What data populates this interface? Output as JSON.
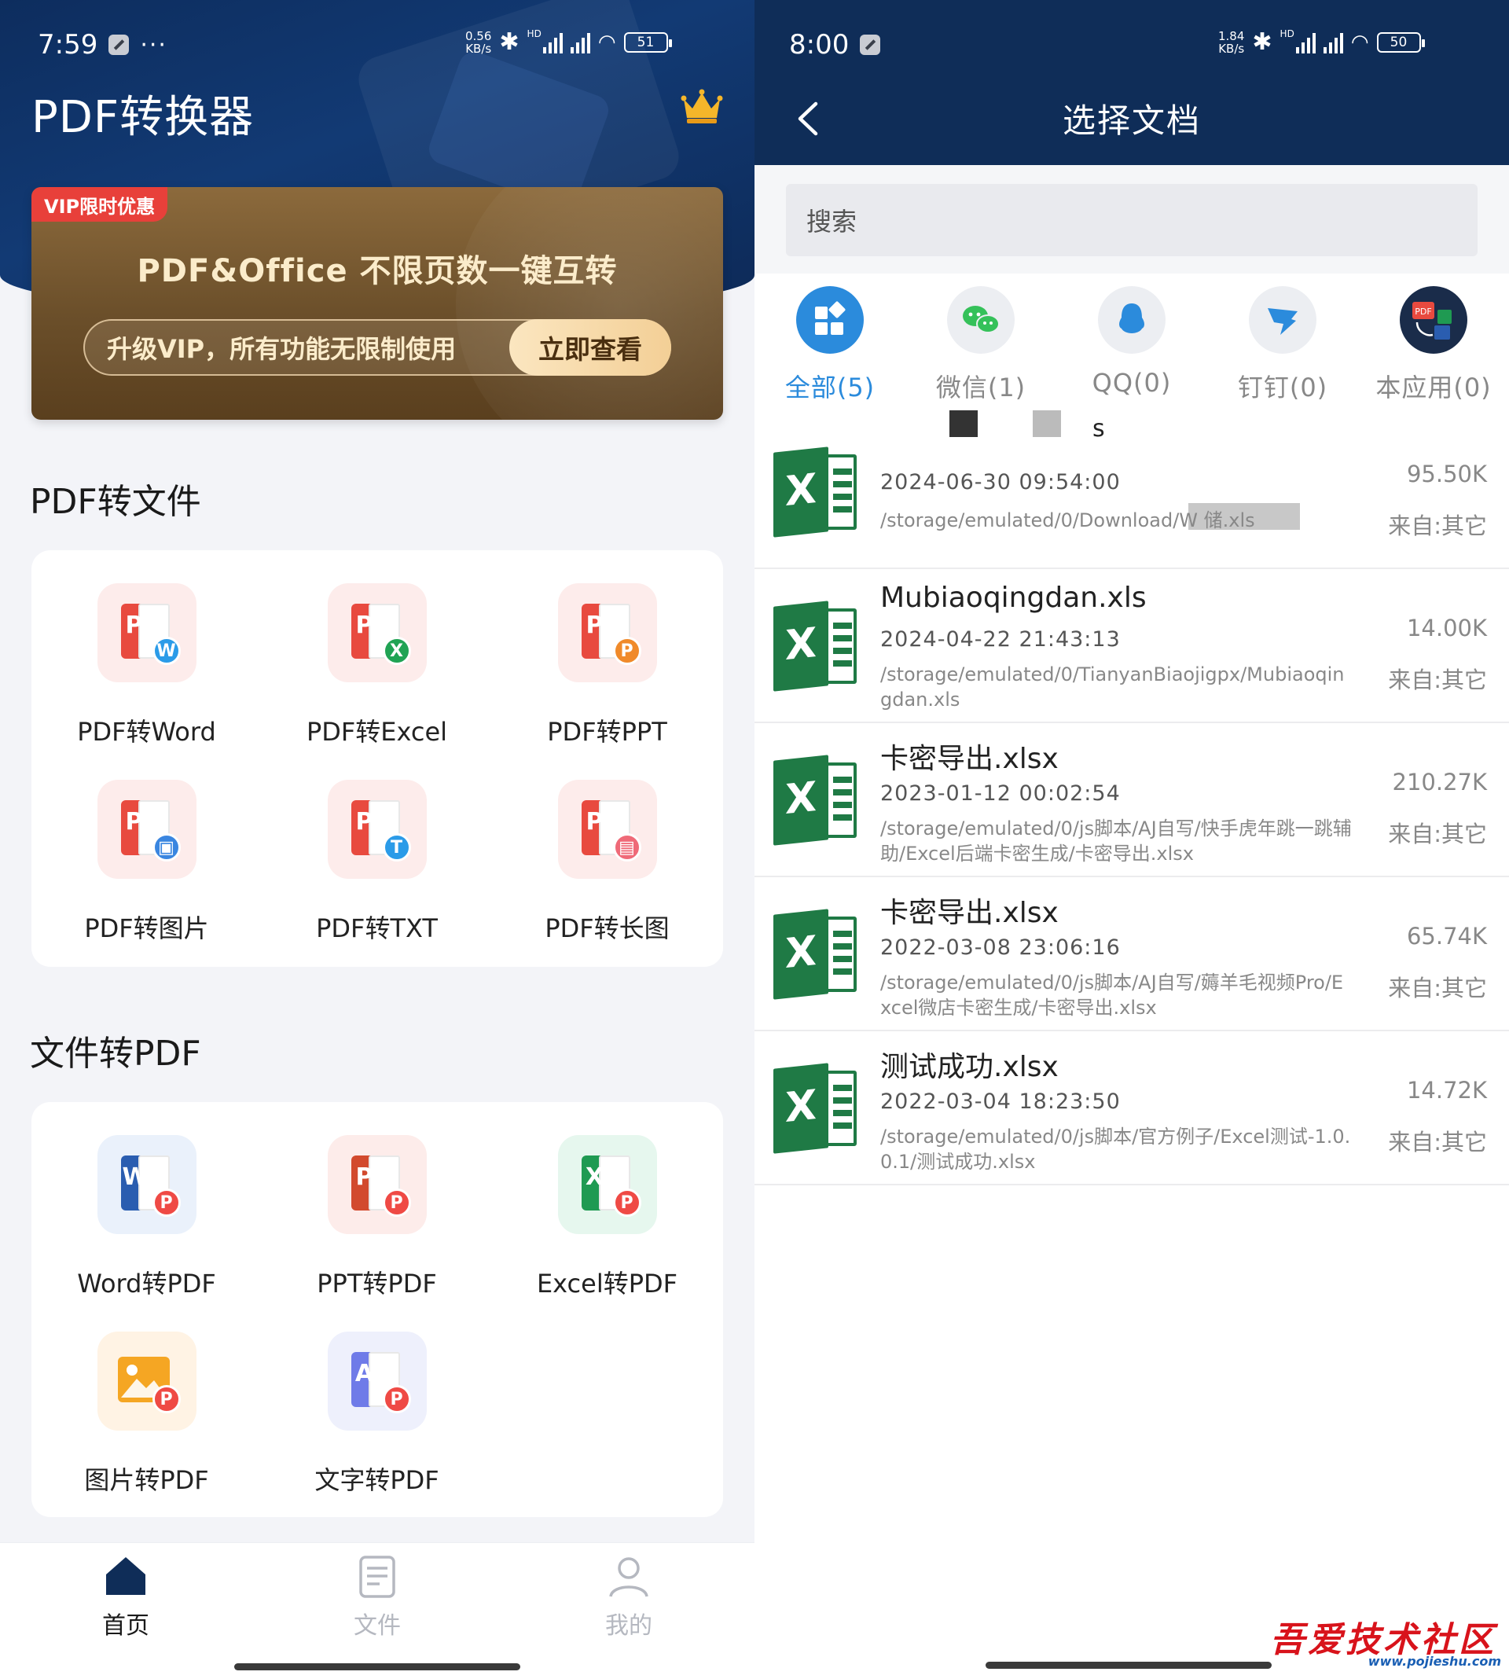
{
  "left_phone": {
    "status": {
      "time": "7:59",
      "dots": "···",
      "speed_top": "0.56",
      "speed_unit": "KB/s",
      "hd": "HD",
      "battery": "51"
    },
    "app_title": "PDF转换器",
    "banner": {
      "tag": "VIP限时优惠",
      "title": "PDF&Office 不限页数一键互转",
      "subtitle": "升级VIP，所有功能无限制使用",
      "button": "立即查看"
    },
    "section_pdf_to_file": {
      "title": "PDF转文件",
      "tools": [
        {
          "label": "PDF转Word",
          "badge": "W",
          "badge_color": "#2b9be8",
          "icon": "pdf-to-word-icon"
        },
        {
          "label": "PDF转Excel",
          "badge": "X",
          "badge_color": "#20a354",
          "icon": "pdf-to-excel-icon"
        },
        {
          "label": "PDF转PPT",
          "badge": "P",
          "badge_color": "#f08a2a",
          "icon": "pdf-to-ppt-icon"
        },
        {
          "label": "PDF转图片",
          "badge": "▣",
          "badge_color": "#3a86e0",
          "icon": "pdf-to-image-icon"
        },
        {
          "label": "PDF转TXT",
          "badge": "T",
          "badge_color": "#2b9be8",
          "icon": "pdf-to-txt-icon"
        },
        {
          "label": "PDF转长图",
          "badge": "▤",
          "badge_color": "#ef6a78",
          "icon": "pdf-to-long-image-icon"
        }
      ]
    },
    "section_file_to_pdf": {
      "title": "文件转PDF",
      "tools": [
        {
          "label": "Word转PDF",
          "letter": "W",
          "doc_color": "#2a5db0",
          "tile_color": "#eaf1fb",
          "icon": "word-to-pdf-icon"
        },
        {
          "label": "PPT转PDF",
          "letter": "P",
          "doc_color": "#d24a2e",
          "tile_color": "#fdecea",
          "icon": "ppt-to-pdf-icon"
        },
        {
          "label": "Excel转PDF",
          "letter": "X",
          "doc_color": "#1f9a52",
          "tile_color": "#e6f7ee",
          "icon": "excel-to-pdf-icon"
        },
        {
          "label": "图片转PDF",
          "letter": "",
          "doc_color": "#f5a623",
          "tile_color": "#fff3e4",
          "icon": "image-to-pdf-icon"
        },
        {
          "label": "文字转PDF",
          "letter": "A",
          "doc_color": "#6f7be8",
          "tile_color": "#eef0fc",
          "icon": "text-to-pdf-icon"
        }
      ]
    },
    "bottom_nav": [
      {
        "label": "首页",
        "active": true,
        "icon": "home-icon"
      },
      {
        "label": "文件",
        "active": false,
        "icon": "file-icon"
      },
      {
        "label": "我的",
        "active": false,
        "icon": "user-icon"
      }
    ],
    "colors": {
      "brand_navy": "#0f2d58",
      "accent_red": "#e84a3f",
      "active_nav": "#0f2d58",
      "inactive_nav": "#b5b8c0"
    }
  },
  "right_phone": {
    "status": {
      "time": "8:00",
      "speed_top": "1.84",
      "speed_unit": "KB/s",
      "hd": "HD",
      "battery": "50"
    },
    "title": "选择文档",
    "search_placeholder": "搜索",
    "tabs": [
      {
        "label": "全部(5)",
        "active": true,
        "icon": "all-grid-icon",
        "color": "#2b8bdc"
      },
      {
        "label": "微信(1)",
        "active": false,
        "icon": "wechat-icon",
        "color": "#eceef2"
      },
      {
        "label": "QQ(0)",
        "active": false,
        "icon": "qq-icon",
        "color": "#eceef2"
      },
      {
        "label": "钉钉(0)",
        "active": false,
        "icon": "dingtalk-icon",
        "color": "#eceef2"
      },
      {
        "label": "本应用(0)",
        "active": false,
        "icon": "this-app-icon",
        "color": "#1a2c4a"
      }
    ],
    "files": [
      {
        "name": "s",
        "date": "2024-06-30 09:54:00",
        "path": "/storage/emulated/0/Download/W 储.xls",
        "size": "95.50K",
        "source": "来自:其它"
      },
      {
        "name": "Mubiaoqingdan.xls",
        "date": "2024-04-22 21:43:13",
        "path": "/storage/emulated/0/TianyanBiaojigpx/Mubiaoqingdan.xls",
        "size": "14.00K",
        "source": "来自:其它"
      },
      {
        "name": "卡密导出.xlsx",
        "date": "2023-01-12 00:02:54",
        "path": "/storage/emulated/0/js脚本/AJ自写/快手虎年跳一跳辅助/Excel后端卡密生成/卡密导出.xlsx",
        "size": "210.27K",
        "source": "来自:其它"
      },
      {
        "name": "卡密导出.xlsx",
        "date": "2022-03-08 23:06:16",
        "path": "/storage/emulated/0/js脚本/AJ自写/薅羊毛视频Pro/Excel微店卡密生成/卡密导出.xlsx",
        "size": "65.74K",
        "source": "来自:其它"
      },
      {
        "name": "测试成功.xlsx",
        "date": "2022-03-04 18:23:50",
        "path": "/storage/emulated/0/js脚本/官方例子/Excel测试-1.0.0.1/测试成功.xlsx",
        "size": "14.72K",
        "source": "来自:其它"
      }
    ]
  },
  "watermark": {
    "text": "吾爱技术社区",
    "url": "www.pojieshu.com"
  }
}
